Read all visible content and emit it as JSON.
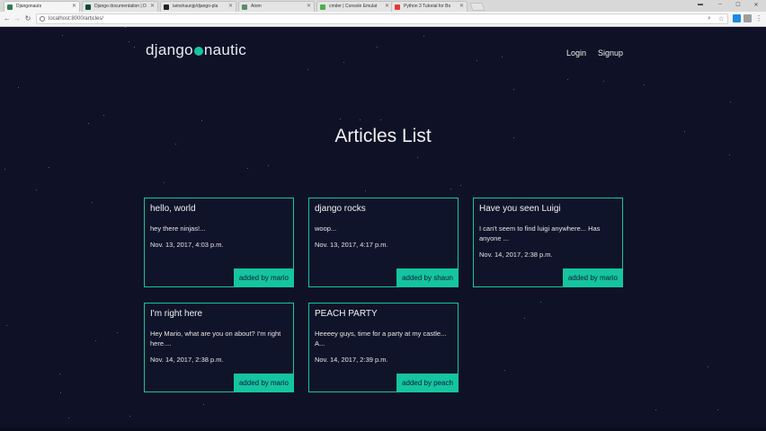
{
  "browser": {
    "tabs": [
      {
        "label": "Djangonauts",
        "favicon_color": "#2f7d55"
      },
      {
        "label": "Django documentation | D",
        "favicon_color": "#0c4b33"
      },
      {
        "label": "iamshaunjp/django-pla",
        "favicon_color": "#222222"
      },
      {
        "label": "Atom",
        "favicon_color": "#5d8a6f"
      },
      {
        "label": "cmder | Console Emulat",
        "favicon_color": "#4caf50"
      },
      {
        "label": "Python 3 Tutorial for Bo",
        "favicon_color": "#e53935"
      }
    ],
    "url": "localhost:8000/articles/"
  },
  "header": {
    "logo_left": "django",
    "logo_right": "nautic",
    "login_label": "Login",
    "signup_label": "Signup"
  },
  "main": {
    "title": "Articles List",
    "articles": [
      {
        "title": "hello, world",
        "snippet": "hey there ninjas!...",
        "date": "Nov. 13, 2017, 4:03 p.m.",
        "author": "added by mario"
      },
      {
        "title": "django rocks",
        "snippet": "woop...",
        "date": "Nov. 13, 2017, 4:17 p.m.",
        "author": "added by shaun"
      },
      {
        "title": "Have you seen Luigi",
        "snippet": "I can't seem to find luigi anywhere... Has anyone ...",
        "date": "Nov. 14, 2017, 2:38 p.m.",
        "author": "added by mario"
      },
      {
        "title": "I'm right here",
        "snippet": "Hey Mario, what are you on about? I'm right here....",
        "date": "Nov. 14, 2017, 2:38 p.m.",
        "author": "added by mario"
      },
      {
        "title": "PEACH PARTY",
        "snippet": "Heeeey guys, time for a party at my castle... A...",
        "date": "Nov. 14, 2017, 2:39 p.m.",
        "author": "added by peach"
      }
    ]
  },
  "colors": {
    "background": "#0f1126",
    "accent": "#14c5a0",
    "text": "#f2f2f2"
  }
}
